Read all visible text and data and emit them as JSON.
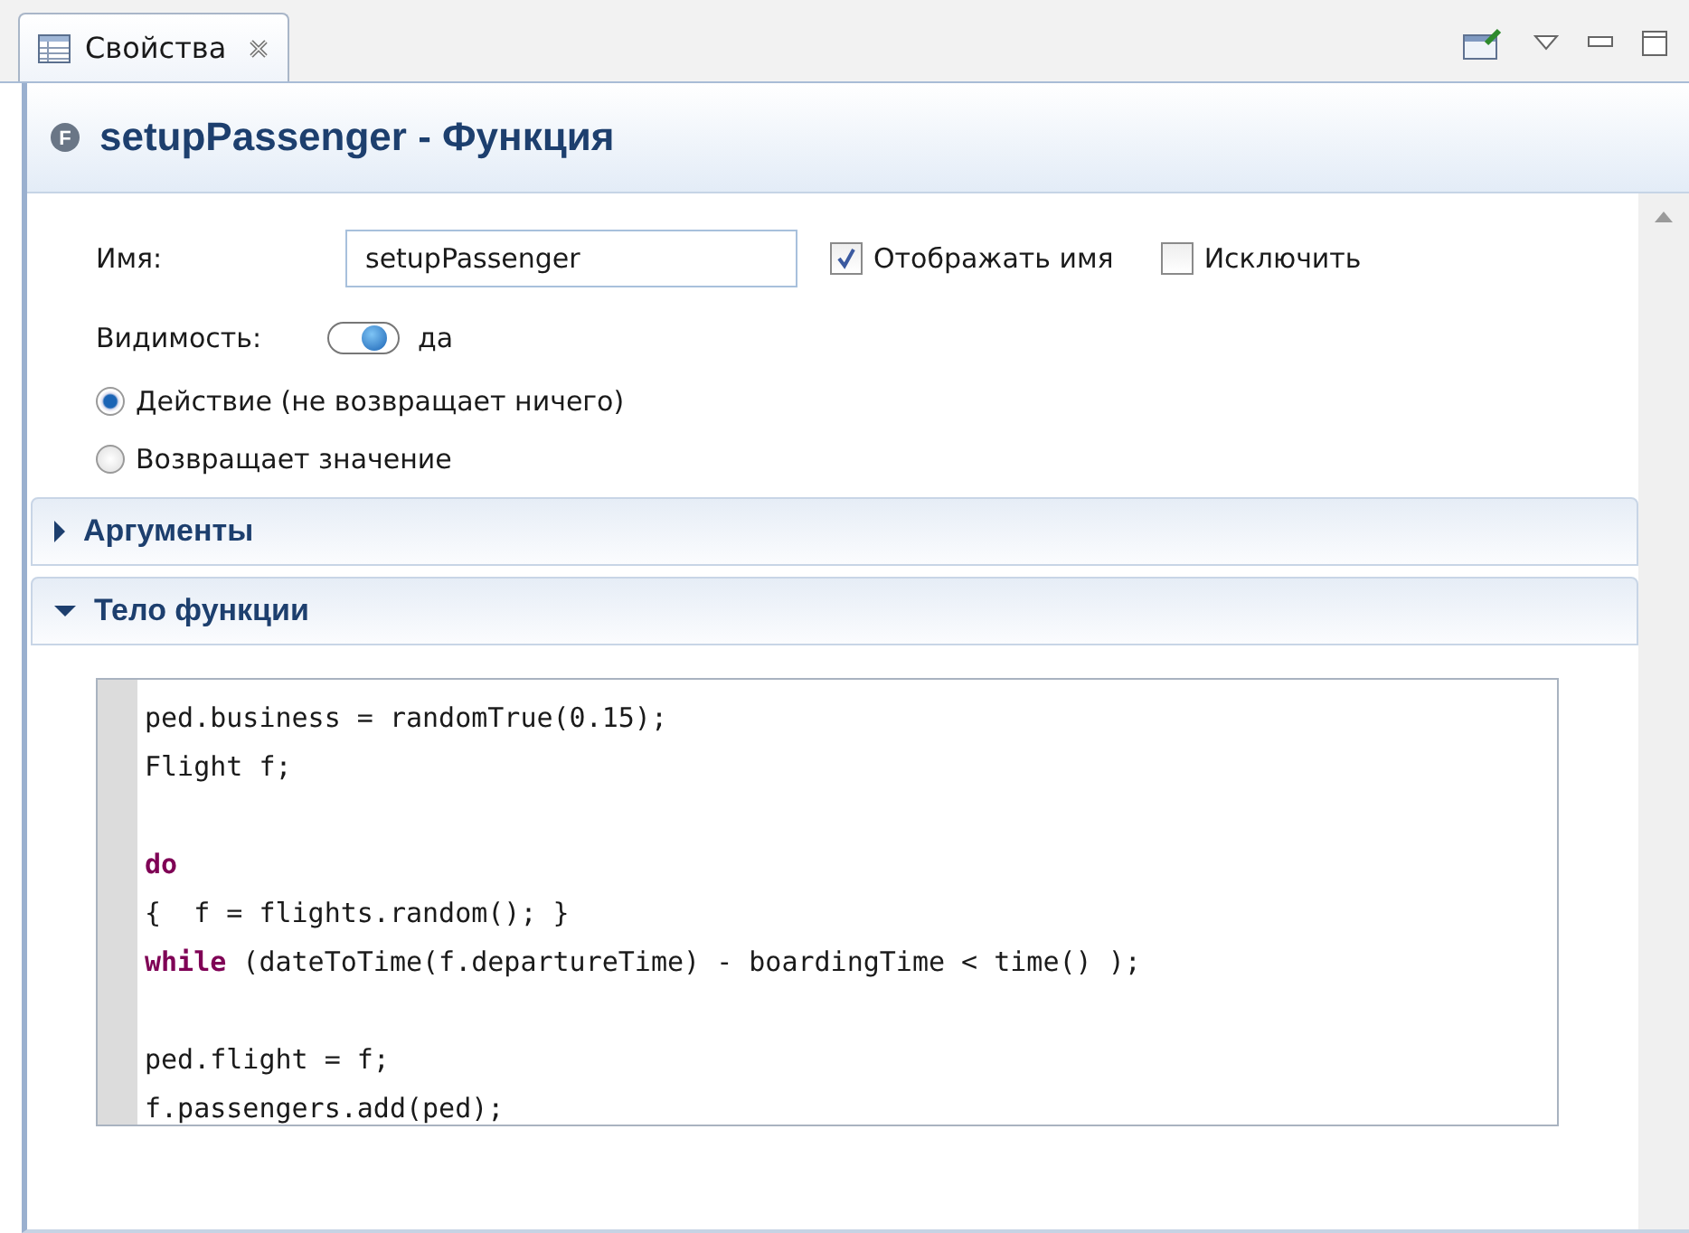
{
  "tab": {
    "label": "Свойства",
    "selected": true
  },
  "header": {
    "title": "setupPassenger - Функция",
    "icon_letter": "F"
  },
  "name_field": {
    "label": "Имя:",
    "value": "setupPassenger"
  },
  "checkboxes": [
    {
      "label": "Отображать имя",
      "checked": true
    },
    {
      "label": "Исключить",
      "checked": false
    }
  ],
  "visibility": {
    "label": "Видимость:",
    "on": true,
    "value": "да"
  },
  "radios": [
    {
      "label": "Действие (не возвращает ничего)",
      "selected": true
    },
    {
      "label": "Возвращает значение",
      "selected": false
    }
  ],
  "sections": [
    {
      "title": "Аргументы",
      "expanded": false
    },
    {
      "title": "Тело функции",
      "expanded": true,
      "code": [
        {
          "kind": "plain",
          "text": "ped.business = randomTrue(0.15);\nFlight f;\n\n"
        },
        {
          "kind": "keyword",
          "text": "do"
        },
        {
          "kind": "plain",
          "text": "\n{  f = flights.random(); }\n"
        },
        {
          "kind": "keyword",
          "text": "while"
        },
        {
          "kind": "plain",
          "text": " (dateToTime(f.departureTime) - boardingTime < time() );\n\nped.flight = f;\nf.passengers.add(ped);"
        }
      ]
    }
  ]
}
